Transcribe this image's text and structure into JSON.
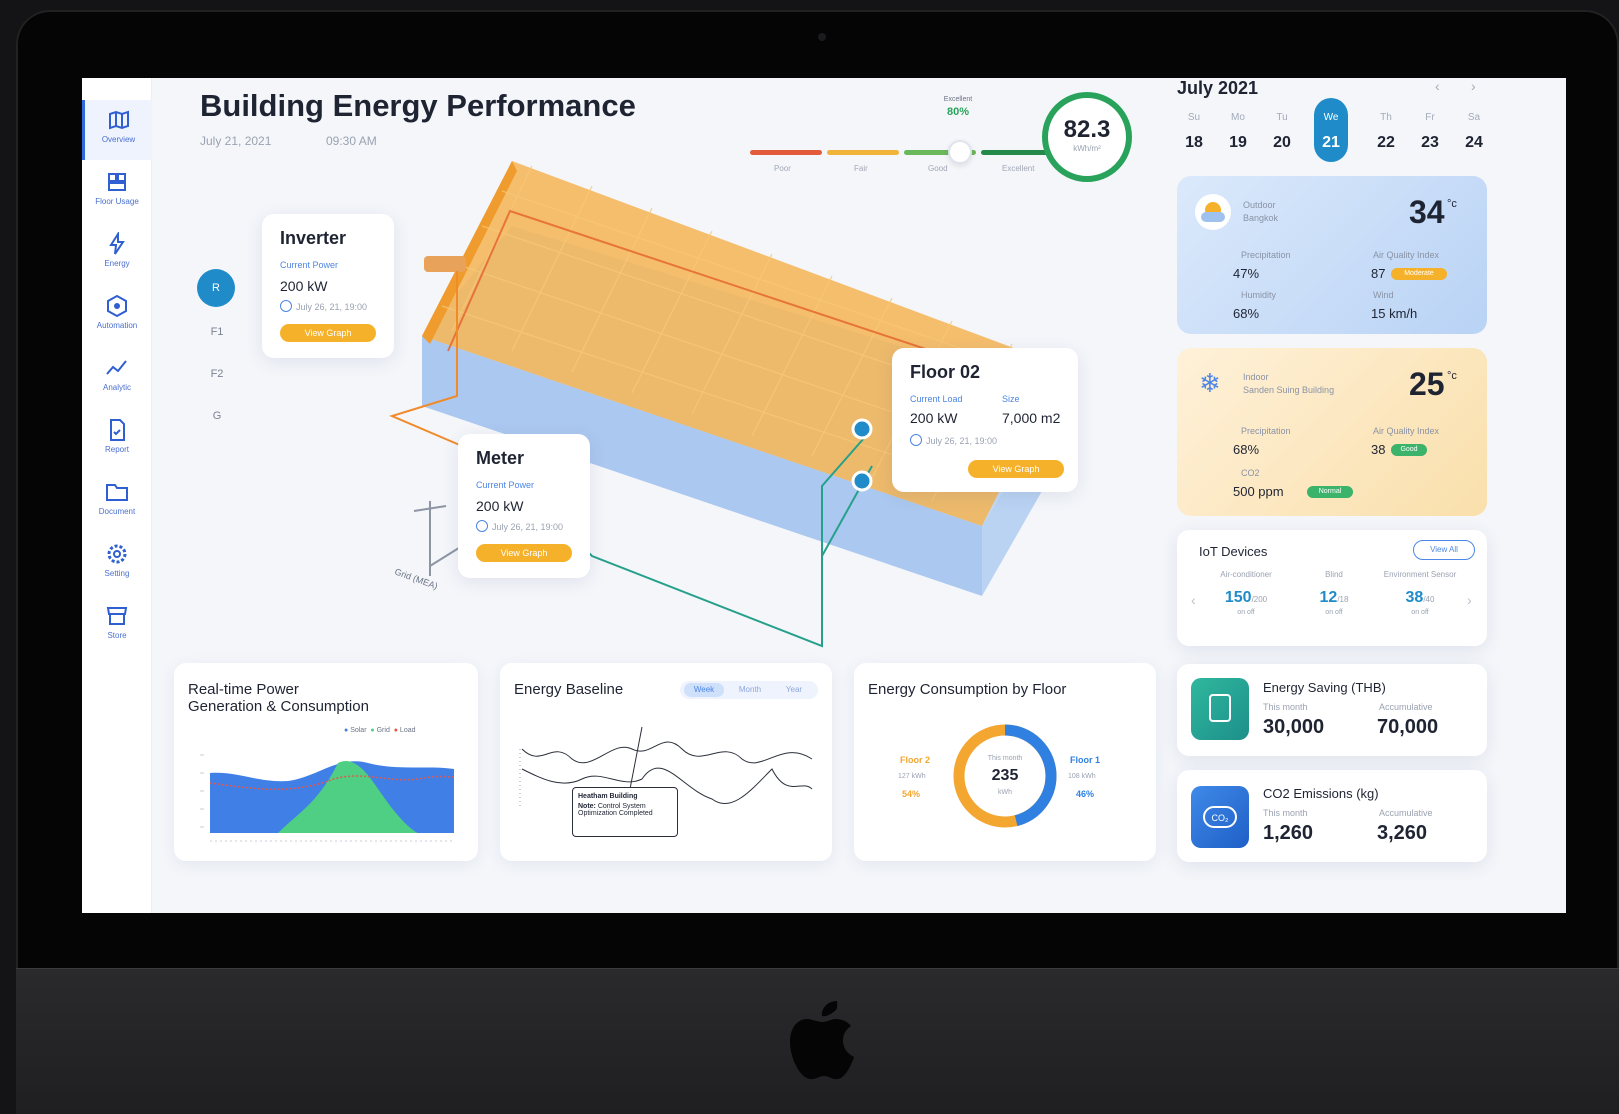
{
  "nav": [
    {
      "label": "Overview",
      "icon": "map-icon",
      "active": true
    },
    {
      "label": "Floor Usage",
      "icon": "floor-usage-icon"
    },
    {
      "label": "Energy",
      "icon": "energy-icon"
    },
    {
      "label": "Automation",
      "icon": "automation-icon"
    },
    {
      "label": "Analytic",
      "icon": "analytic-icon"
    },
    {
      "label": "Report",
      "icon": "report-icon"
    },
    {
      "label": "Document",
      "icon": "folder-icon"
    },
    {
      "label": "Setting",
      "icon": "gear-icon"
    },
    {
      "label": "Store",
      "icon": "store-icon"
    }
  ],
  "header": {
    "title": "Building Energy Performance",
    "date": "July 21, 2021",
    "time": "09:30 AM"
  },
  "rating": {
    "current_label": "Excellent",
    "current_pct": "80%",
    "levels": [
      "Poor",
      "Fair",
      "Good",
      "Excellent"
    ],
    "score": "82.3",
    "score_unit": "kWh/m²",
    "colors": {
      "poor": "#e25c3b",
      "fair": "#f0b43a",
      "good": "#69b85a",
      "excellent": "#238a4a"
    }
  },
  "floors": [
    "R",
    "F1",
    "F2",
    "G"
  ],
  "inverter": {
    "title": "Inverter",
    "label": "Current Power",
    "value": "200 kW",
    "meta": "July 26, 21, 19:00",
    "button": "View Graph"
  },
  "meter": {
    "title": "Meter",
    "label": "Current Power",
    "value": "200 kW",
    "meta": "July 26, 21, 19:00",
    "button": "View Graph"
  },
  "floor02": {
    "title": "Floor 02",
    "label_load": "Current Load",
    "label_size": "Size",
    "load": "200 kW",
    "size": "7,000 m2",
    "meta": "July 26, 21, 19:00",
    "button": "View Graph"
  },
  "grid_label": "Grid (MEA)",
  "calendar": {
    "month": "July 2021",
    "days": [
      {
        "dow": "Su",
        "d": "18"
      },
      {
        "dow": "Mo",
        "d": "19"
      },
      {
        "dow": "Tu",
        "d": "20"
      },
      {
        "dow": "We",
        "d": "21"
      },
      {
        "dow": "Th",
        "d": "22"
      },
      {
        "dow": "Fr",
        "d": "23"
      },
      {
        "dow": "Sa",
        "d": "24"
      }
    ]
  },
  "outdoor": {
    "title": "Outdoor",
    "place": "Bangkok",
    "temp": "34",
    "precip_label": "Precipitation",
    "precip": "47%",
    "aqi_label": "Air Quality Index",
    "aqi": "87",
    "aqi_badge": "Moderate",
    "humidity_label": "Humidity",
    "humidity": "68%",
    "wind_label": "Wind",
    "wind": "15 km/h"
  },
  "indoor": {
    "title": "Indoor",
    "place": "Sanden Suing Building",
    "temp": "25",
    "precip_label": "Precipitation",
    "precip": "68%",
    "aqi_label": "Air Quality Index",
    "aqi": "38",
    "aqi_badge": "Good",
    "co2_label": "CO2",
    "co2": "500 ppm",
    "co2_badge": "Normal"
  },
  "iot": {
    "title": "IoT Devices",
    "view_all": "View All",
    "devices": [
      {
        "name": "Air-conditioner",
        "count": "150",
        "total": "/200",
        "on": "on",
        "off": "off"
      },
      {
        "name": "Blind",
        "count": "12",
        "total": "/18",
        "on": "on",
        "off": "off"
      },
      {
        "name": "Environment Sensor",
        "count": "38",
        "total": "/40",
        "on": "on",
        "off": "off"
      }
    ]
  },
  "realtime": {
    "title_l1": "Real-time Power",
    "title_l2": "Generation & Consumption",
    "legend": [
      "Solar",
      "Grid",
      "Load"
    ],
    "colors": {
      "solar": "#3f7fe6",
      "grid": "#4fcf83",
      "load": "#e8564a"
    }
  },
  "baseline": {
    "title": "Energy Baseline",
    "tabs": [
      "Week",
      "Month",
      "Year"
    ],
    "tooltip_title": "Heatham Building",
    "tooltip_note_label": "Note:",
    "tooltip_note": "Control System Optimization Completed"
  },
  "consumption": {
    "title": "Energy Consumption by Floor",
    "center_label": "This month",
    "center_value": "235",
    "center_unit": "kWh",
    "left": {
      "name": "Floor 2",
      "value": "127 kWh",
      "pct": "54%"
    },
    "right": {
      "name": "Floor 1",
      "value": "108 kWh",
      "pct": "46%"
    },
    "colors": {
      "left": "#f3a731",
      "right": "#2f80e0"
    }
  },
  "saving": {
    "title": "Energy Saving (THB)",
    "label_a": "This month",
    "value_a": "30,000",
    "label_b": "Accumulative",
    "value_b": "70,000"
  },
  "co2": {
    "title": "CO2 Emissions (kg)",
    "label_a": "This month",
    "value_a": "1,260",
    "label_b": "Accumulative",
    "value_b": "3,260"
  }
}
